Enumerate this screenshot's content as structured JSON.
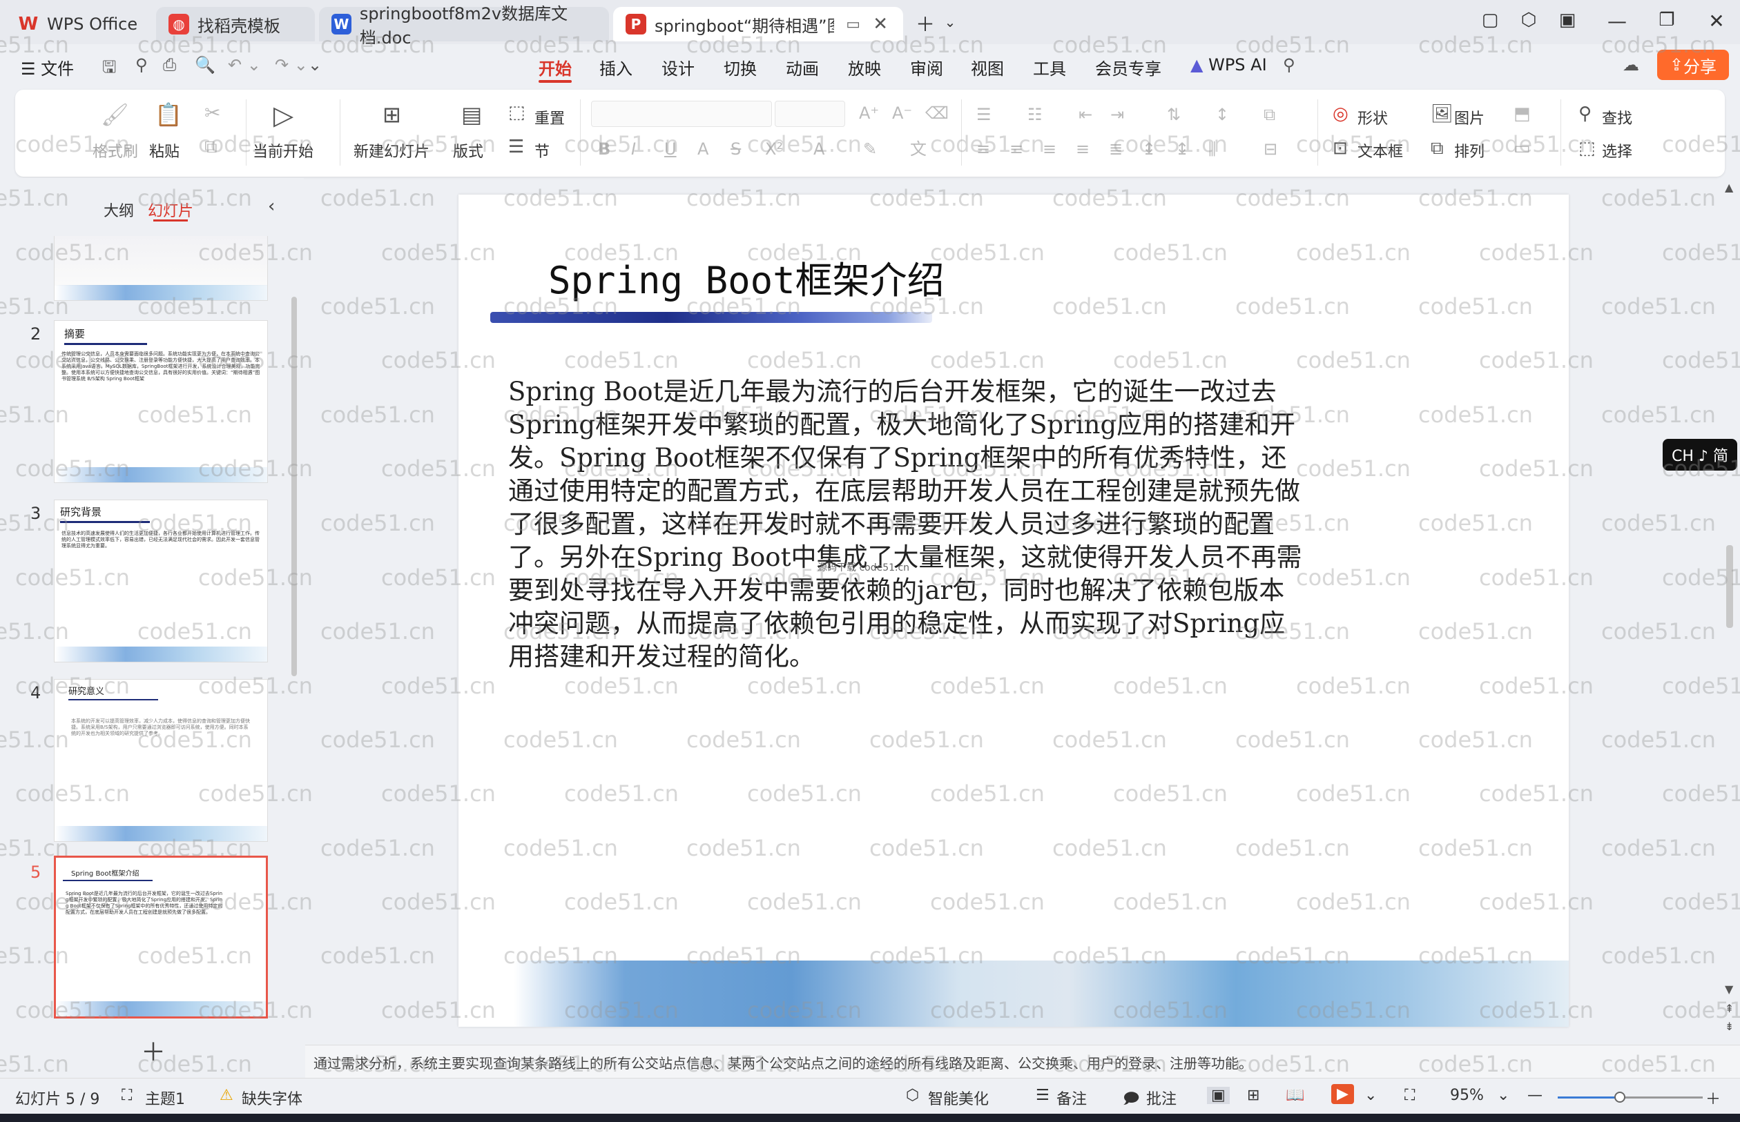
{
  "tabs": [
    {
      "label": "WPS Office",
      "icon": "wps-logo-icon"
    },
    {
      "label": "找稻壳模板",
      "icon": "docer-icon"
    },
    {
      "label": "springbootf8m2v数据库文档.doc",
      "icon": "word-doc-icon"
    },
    {
      "label": "springboot“期待相遇”图·",
      "icon": "ppt-icon"
    }
  ],
  "menubar": {
    "file": "文件",
    "items": [
      "开始",
      "插入",
      "设计",
      "切换",
      "动画",
      "放映",
      "审阅",
      "视图",
      "工具",
      "会员专享"
    ],
    "active": "开始",
    "wps_ai": "WPS AI",
    "share": "分享"
  },
  "ribbon": {
    "format_painter": "格式刷",
    "paste": "粘贴",
    "from_current": "当前开始",
    "new_slide": "新建幻灯片",
    "layout": "版式",
    "reset": "重置",
    "section": "节",
    "shape": "形状",
    "picture": "图片",
    "textbox": "文本框",
    "arrange": "排列",
    "find": "查找",
    "select": "选择"
  },
  "leftpane": {
    "outline": "大纲",
    "slides": "幻灯片"
  },
  "thumbs": [
    {
      "num": "2",
      "title": "摘要",
      "text": "传统管理公交信息，人员本身需要面临很多问题。系统功能实现更为方便，在本系统中查询公交站点信息，公交线路、公交换乘、注册登录等功能方便快捷，大大提高了用户查询效率。本系统采用Java语言，MySQL数据库，SpringBoot框架进行开发，系统设计合理美观，功能完整。使用本系统可以方便快捷地查询公交信息，具有很好的实用价值。关键词：“期待相遇”图书管理系统 B/S架构 Spring Boot框架"
    },
    {
      "num": "3",
      "title": "研究背景",
      "text": "信息技术的高速发展使得人们的生活更加便捷，各行各业都开始使用计算机进行管理工作。传统的人工管理模式效率低下，容易出错，已经无法满足现代社会的需求。因此开发一套信息管理系统显得尤为重要。"
    },
    {
      "num": "4",
      "title": "研究意义",
      "text": "本系统的开发可以提高管理效率，减少人力成本，使得信息的查询和管理更加方便快捷。系统采用B/S架构，用户只需要通过浏览器即可访问系统，使用方便。同时本系统的开发也为相关领域的研究提供了参考。"
    },
    {
      "num": "5",
      "title": "Spring Boot框架介绍",
      "text": "Spring Boot是近几年最为流行的后台开发框架，它的诞生一改过去Spring框架开发中繁琐的配置，极大地简化了Spring应用的搭建和开发。Spring Boot框架不仅保有了Spring框架中的所有优秀特性，还通过使用特定的配置方式，在底层帮助开发人员在工程创建是就预先做了很多配置。"
    }
  ],
  "slide": {
    "title": "Spring Boot框架介绍",
    "body": "Spring Boot是近几年最为流行的后台开发框架，它的诞生一改过去Spring框架开发中繁琐的配置，极大地简化了Spring应用的搭建和开发。Spring Boot框架不仅保有了Spring框架中的所有优秀特性，还通过使用特定的配置方式，在底层帮助开发人员在工程创建是就预先做了很多配置，这样在开发时就不再需要开发人员过多进行繁琐的配置了。另外在Spring Boot中集成了大量框架，这就使得开发人员不再需要到处寻找在导入开发中需要依赖的jar包，同时也解决了依赖包版本冲突问题，从而提高了依赖包引用的稳定性，从而实现了对Spring应用搭建和开发过程的简化。",
    "small_text": "源码下载 code51.cn"
  },
  "notes": "通过需求分析，系统主要实现查询某条路线上的所有公交站点信息、某两个公交站点之间的途经的所有线路及距离、公交换乘、用户的登录、注册等功能。",
  "status": {
    "slide_counter": "幻灯片 5 / 9",
    "theme": "主题1",
    "missing_font": "缺失字体",
    "smart_beautify": "智能美化",
    "notes": "备注",
    "comment": "批注",
    "zoom": "95%"
  },
  "ime": "CH ♪ 简",
  "watermark": "code51.cn"
}
